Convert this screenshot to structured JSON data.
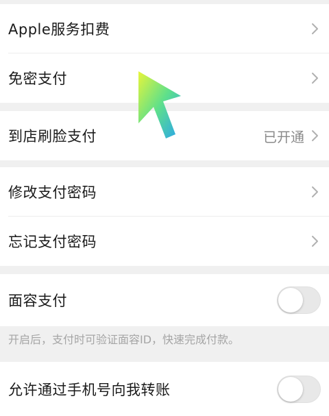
{
  "groups": [
    {
      "rows": [
        {
          "label": "Apple服务扣费",
          "icon": "chevron-right-icon"
        },
        {
          "label": "免密支付",
          "icon": "chevron-right-icon"
        }
      ]
    },
    {
      "rows": [
        {
          "label": "到店刷脸支付",
          "status": "已开通",
          "icon": "chevron-right-icon"
        }
      ]
    },
    {
      "rows": [
        {
          "label": "修改支付密码",
          "icon": "chevron-right-icon"
        },
        {
          "label": "忘记支付密码",
          "icon": "chevron-right-icon"
        }
      ]
    },
    {
      "rows": [
        {
          "label": "面容支付",
          "toggle_on": false
        }
      ],
      "note": "开启后，支付时可验证面容ID，快速完成付款。"
    },
    {
      "rows": [
        {
          "label": "允许通过手机号向我转账",
          "toggle_on": false
        }
      ]
    }
  ],
  "colors": {
    "background": "#f0f0f0",
    "card": "#ffffff",
    "secondary_text": "#8a8a8a",
    "note_text": "#a5a5a5",
    "chevron": "#b0b0b0",
    "toggle_off": "#e8e8e8"
  },
  "overlay": {
    "icon": "pointer-arrow-icon"
  }
}
